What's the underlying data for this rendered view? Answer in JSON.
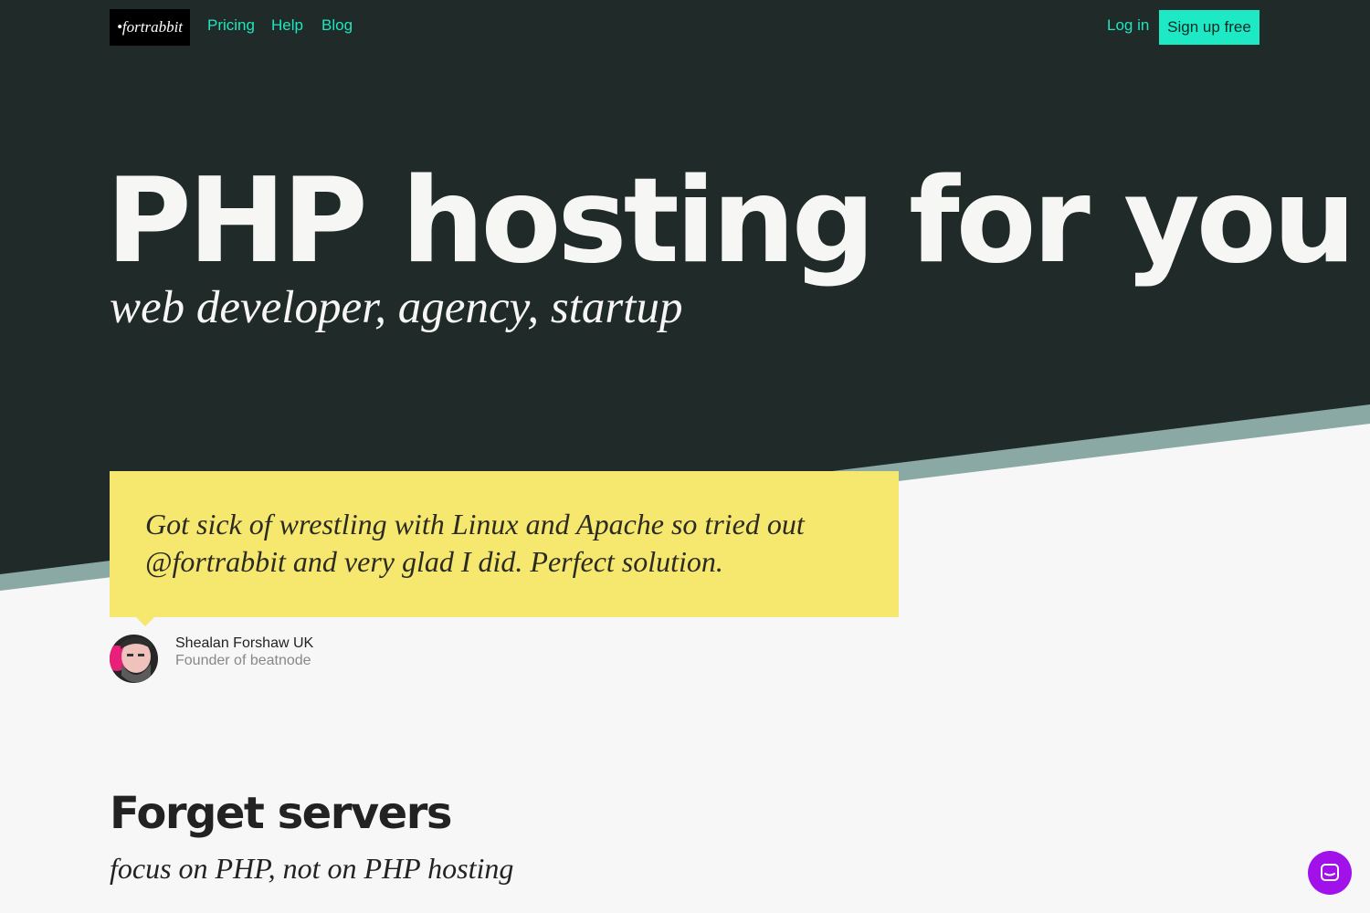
{
  "colors": {
    "hero_bg": "#1f2a29",
    "stripe": "#8aa9a4",
    "accent": "#1de9c4",
    "quote_bg": "#f6e86e",
    "chat_bg": "#a112ea"
  },
  "header": {
    "logo": "•fortrabbit",
    "nav": [
      "Pricing",
      "Help",
      "Blog"
    ],
    "login": "Log in",
    "signup": "Sign up free"
  },
  "hero": {
    "title": "PHP hosting for you",
    "subtitle": "web developer, agency, startup"
  },
  "testimonial": {
    "quote": "Got sick of wrestling with Linux and Apache so tried out @fortrabbit and very glad I did. Perfect solution.",
    "author": "Shealan Forshaw UK",
    "role": "Founder of beatnode",
    "avatar_icon": "avatar-portrait"
  },
  "section": {
    "title": "Forget servers",
    "subtitle": "focus on PHP, not on PHP hosting"
  },
  "chat": {
    "icon": "chat-bubble-icon"
  }
}
